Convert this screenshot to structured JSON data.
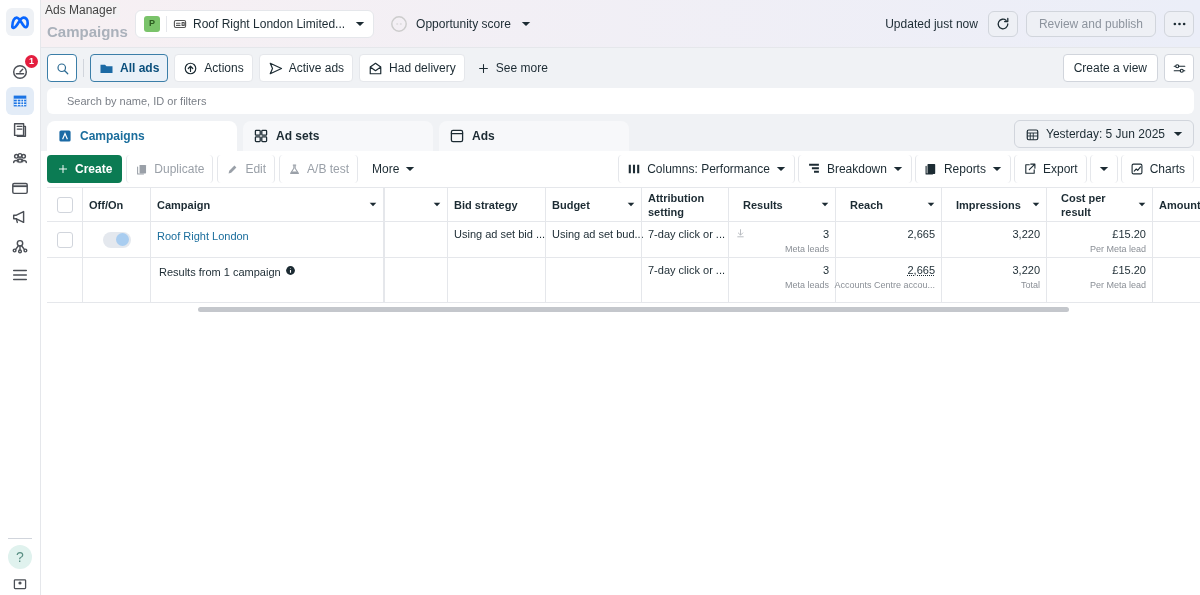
{
  "sidebar": {
    "items": [
      {
        "selected": false,
        "badge": "1"
      },
      {
        "selected": true
      },
      {
        "selected": false
      },
      {
        "selected": false
      },
      {
        "selected": false
      },
      {
        "selected": false
      },
      {
        "selected": false
      },
      {
        "selected": false
      }
    ],
    "help": "?"
  },
  "header": {
    "title": "Campaigns",
    "tooltip": "Ads Manager",
    "account_badge": "P",
    "account": "Roof Right London Limited...",
    "opportunity": "Opportunity score",
    "updated": "Updated just now",
    "publish": {
      "label": "Review and publish",
      "disabled": true
    }
  },
  "filters": [
    {
      "label": "All ads",
      "selected": true
    },
    {
      "label": "Actions",
      "selected": false
    },
    {
      "label": "Active ads",
      "selected": false
    },
    {
      "label": "Had delivery",
      "selected": false
    }
  ],
  "see_more": "See more",
  "create_view": "Create a view",
  "search": {
    "placeholder": "Search by name, ID or filters"
  },
  "tabs": [
    {
      "label": "Campaigns",
      "selected": true
    },
    {
      "label": "Ad sets",
      "selected": false
    },
    {
      "label": "Ads",
      "selected": false
    }
  ],
  "date_range": "Yesterday: 5 Jun 2025",
  "toolbar": {
    "left": [
      {
        "label": "Create",
        "kind": "primary"
      },
      {
        "label": "Duplicate",
        "kind": "icon",
        "disabled": true
      },
      {
        "label": "Edit",
        "kind": "icon",
        "disabled": true
      },
      {
        "label": "A/B test",
        "kind": "icon",
        "disabled": true
      },
      {
        "label": "More",
        "kind": "menu"
      }
    ],
    "right": [
      {
        "label": "Columns: Performance",
        "caret": true
      },
      {
        "label": "Breakdown",
        "caret": true
      },
      {
        "label": "Reports",
        "caret": true
      },
      {
        "label": "Export",
        "caret": false
      },
      {
        "caret": true
      },
      {
        "label": "Charts",
        "caret": false
      }
    ]
  },
  "table": {
    "all_checked": false,
    "columns": [
      {
        "label": "Off/On",
        "sort": false
      },
      {
        "label": "Campaign",
        "sort": true
      },
      {
        "sort": true
      },
      {
        "label": "Bid strategy",
        "sort": false
      },
      {
        "label": "Budget",
        "sort": true
      },
      {
        "label": "Attribution setting",
        "sort": false
      },
      {
        "label": "Results",
        "sort": true
      },
      {
        "label": "Reach",
        "sort": true
      },
      {
        "label": "Impressions",
        "sort": true
      },
      {
        "label": "Cost per result",
        "sort": true
      },
      {
        "label": "Amount",
        "sort": false
      }
    ],
    "rows": [
      {
        "kind": "campaign",
        "checked": false,
        "on": true,
        "cells": [
          "",
          {
            "text": "Roof Right London"
          },
          "",
          {
            "text": "Using ad set bid ..."
          },
          {
            "text": "Using ad set bud..."
          },
          {
            "text": "7-day click or ..."
          },
          {
            "text": "3",
            "sub": "Meta leads"
          },
          {
            "text": "2,665"
          },
          {
            "text": "3,220"
          },
          {
            "text": "£15.20",
            "sub": "Per Meta lead"
          },
          ""
        ]
      },
      {
        "kind": "summary",
        "cells": [
          "",
          {
            "text": "Results from 1 campaign"
          },
          "",
          "",
          "",
          {
            "text": "7-day click or ..."
          },
          {
            "text": "3",
            "sub": "Meta leads"
          },
          {
            "text": "2,665",
            "sub": "Accounts Centre accou..."
          },
          {
            "text": "3,220",
            "sub": "Total"
          },
          {
            "text": "£15.20",
            "sub": "Per Meta lead"
          },
          ""
        ]
      }
    ]
  }
}
